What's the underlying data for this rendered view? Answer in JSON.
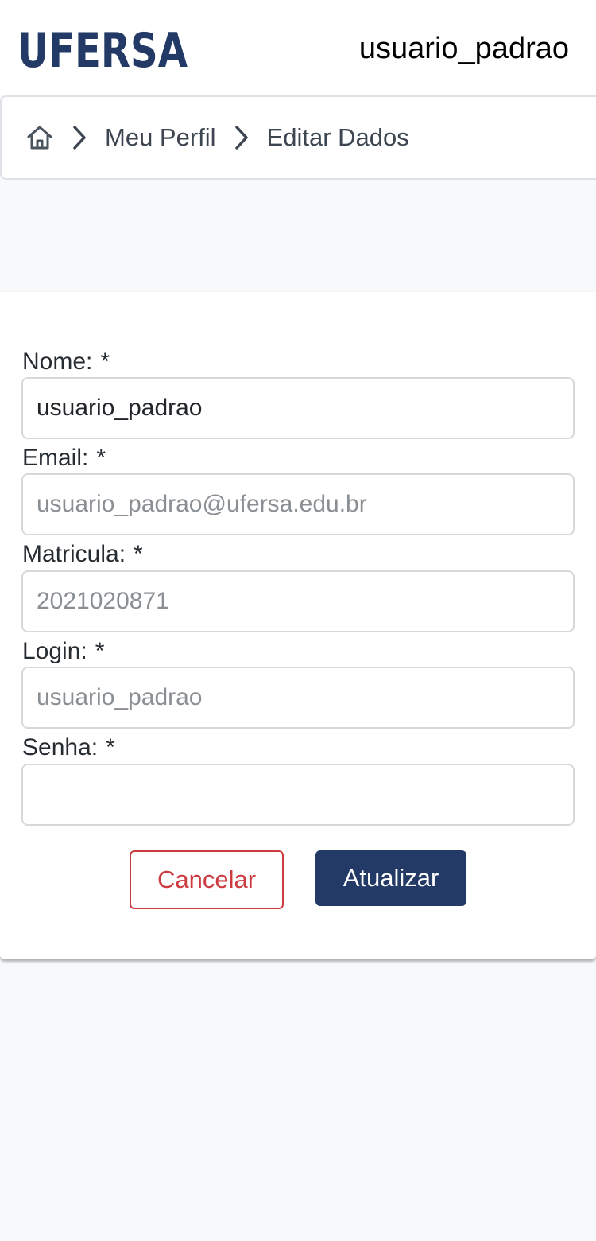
{
  "header": {
    "logo_text": "UFERSA",
    "username": "usuario_padrao",
    "brand_color": "#233a66"
  },
  "breadcrumb": {
    "home_icon": "home-icon",
    "separator_icon": "chevron-right-icon",
    "items": [
      {
        "label": "Meu Perfil"
      },
      {
        "label": "Editar Dados"
      }
    ]
  },
  "form": {
    "required_marker": "*",
    "fields": [
      {
        "label": "Nome:",
        "value": "usuario_padrao",
        "readonly": false
      },
      {
        "label": "Email:",
        "value": "usuario_padrao@ufersa.edu.br",
        "readonly": true
      },
      {
        "label": "Matricula:",
        "value": "2021020871",
        "readonly": true
      },
      {
        "label": "Login:",
        "value": "usuario_padrao",
        "readonly": true
      },
      {
        "label": "Senha:",
        "value": "",
        "readonly": false
      }
    ],
    "cancel_label": "Cancelar",
    "submit_label": "Atualizar",
    "cancel_color": "#cc3b3f",
    "submit_color": "#233a66"
  }
}
